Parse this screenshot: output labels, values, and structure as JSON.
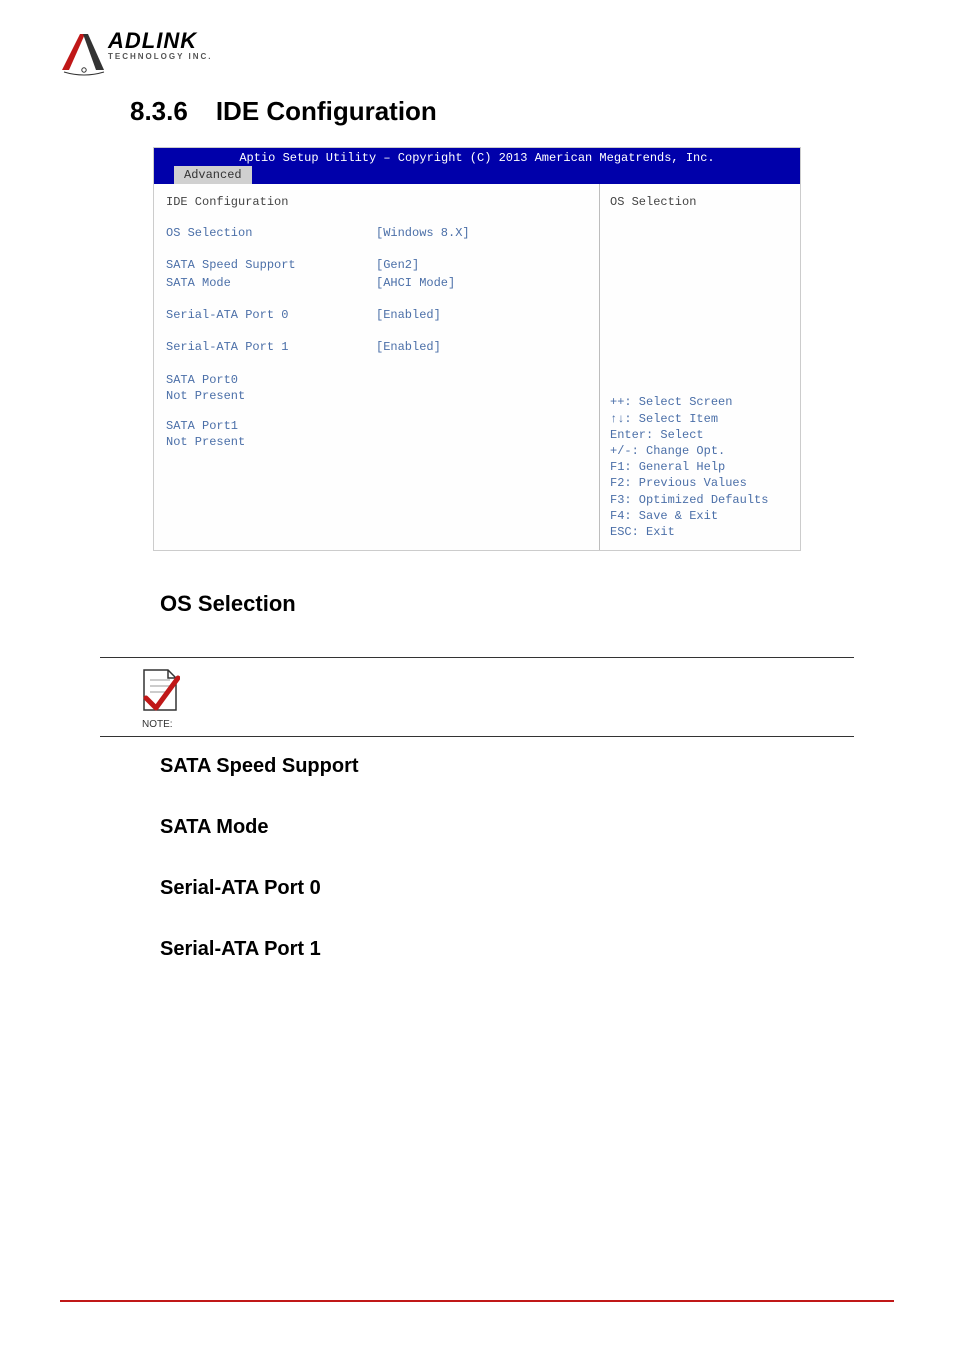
{
  "logo": {
    "text_main": "ADLINK",
    "text_sub": "TECHNOLOGY INC."
  },
  "section": {
    "number": "8.3.6",
    "title": "IDE Configuration"
  },
  "bios": {
    "header": "Aptio Setup Utility – Copyright (C) 2013 American Megatrends, Inc.",
    "tab": "Advanced",
    "panel_title": "IDE Configuration",
    "rows": [
      {
        "label": "OS Selection",
        "value": "[Windows 8.X]"
      },
      {
        "label": "SATA Speed Support",
        "value": "[Gen2]"
      },
      {
        "label": "SATA Mode",
        "value": "[AHCI Mode]"
      },
      {
        "label": "Serial-ATA Port 0",
        "value": "[Enabled]"
      },
      {
        "label": "Serial-ATA Port 1",
        "value": "[Enabled]"
      }
    ],
    "ports": [
      {
        "name": "SATA Port0",
        "status": "Not Present"
      },
      {
        "name": "SATA Port1",
        "status": "Not Present"
      }
    ],
    "help_title": "OS Selection",
    "keys": [
      "++: Select Screen",
      "↑↓: Select Item",
      "Enter: Select",
      "+/-: Change Opt.",
      "F1: General Help",
      "F2: Previous Values",
      "F3: Optimized Defaults",
      "F4: Save & Exit",
      "ESC: Exit"
    ]
  },
  "body_headings": {
    "os_selection": "OS Selection",
    "note_label": "NOTE:",
    "sata_speed": "SATA Speed Support",
    "sata_mode": "SATA Mode",
    "sata_port0": "Serial-ATA Port 0",
    "sata_port1": "Serial-ATA Port 1"
  }
}
